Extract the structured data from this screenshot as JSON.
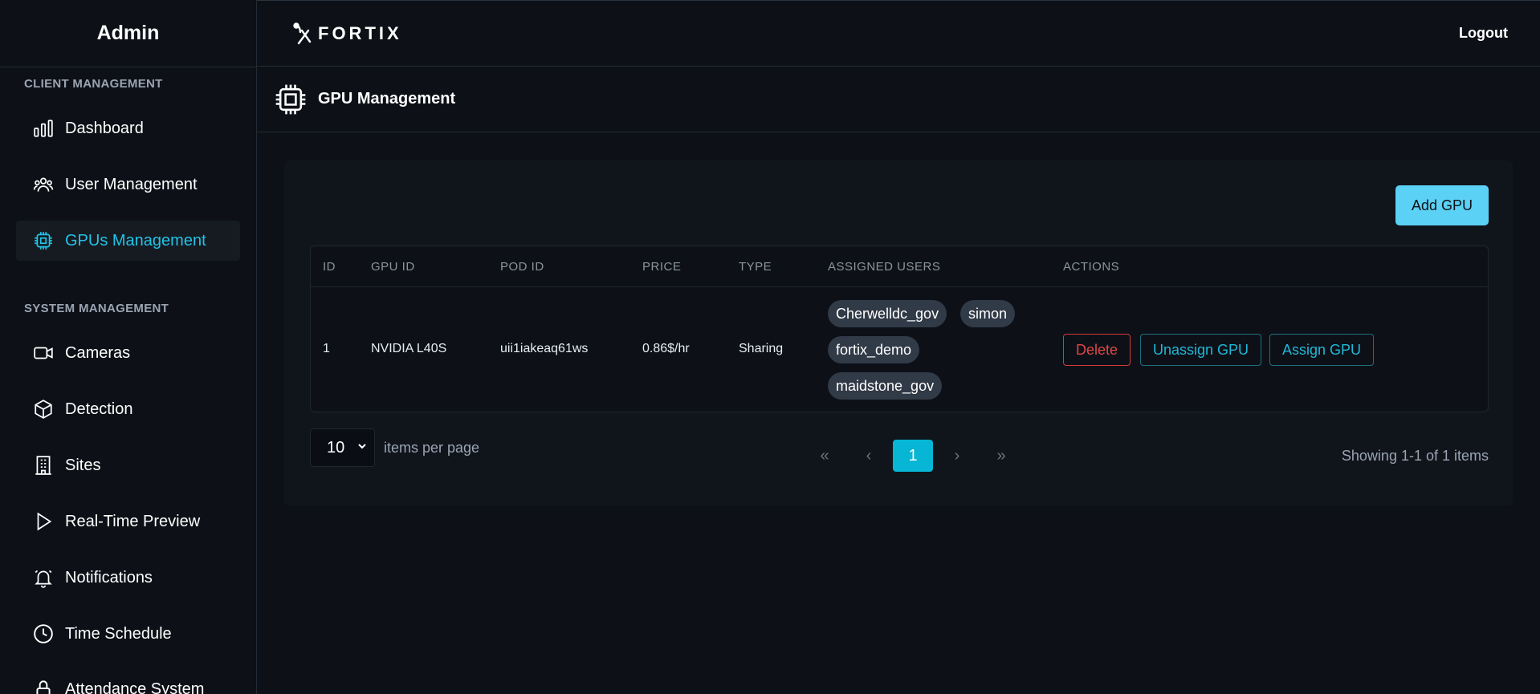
{
  "sidebar": {
    "title": "Admin",
    "client_section": "CLIENT MANAGEMENT",
    "system_section": "SYSTEM MANAGEMENT",
    "items": [
      {
        "label": "Dashboard",
        "icon": "bar-chart-icon"
      },
      {
        "label": "User Management",
        "icon": "users-icon"
      },
      {
        "label": "GPUs Management",
        "icon": "cpu-chip-icon",
        "active": true
      },
      {
        "label": "Cameras",
        "icon": "video-camera-icon"
      },
      {
        "label": "Detection",
        "icon": "cube-icon"
      },
      {
        "label": "Sites",
        "icon": "building-icon"
      },
      {
        "label": "Real-Time Preview",
        "icon": "play-icon"
      },
      {
        "label": "Notifications",
        "icon": "bell-icon"
      },
      {
        "label": "Time Schedule",
        "icon": "clock-icon"
      },
      {
        "label": "Attendance System",
        "icon": "lock-icon"
      }
    ]
  },
  "header": {
    "logo_text": "FORTIX",
    "logout_label": "Logout"
  },
  "page": {
    "title": "GPU Management",
    "add_button": "Add GPU"
  },
  "table": {
    "columns": [
      "ID",
      "GPU ID",
      "POD ID",
      "PRICE",
      "TYPE",
      "ASSIGNED USERS",
      "ACTIONS"
    ],
    "rows": [
      {
        "id": "1",
        "gpu_id": "NVIDIA L40S",
        "pod_id": "uii1iakeaq61ws",
        "price": "0.86$/hr",
        "type": "Sharing",
        "assigned_users": [
          "Cherwelldc_gov",
          "simon",
          "fortix_demo",
          "maidstone_gov"
        ],
        "actions": [
          "Delete",
          "Unassign GPU",
          "Assign GPU"
        ]
      }
    ]
  },
  "pagination": {
    "per_page": "10",
    "per_page_label": "items per page",
    "first": "«",
    "prev": "‹",
    "current_page": "1",
    "next": "›",
    "last": "»",
    "showing": "Showing 1-1 of 1 items"
  },
  "colors": {
    "accent": "#22c3e6",
    "add_button": "#5bd1f5",
    "active_page": "#06b6d4",
    "danger": "#e04646",
    "background": "#0d1117"
  }
}
